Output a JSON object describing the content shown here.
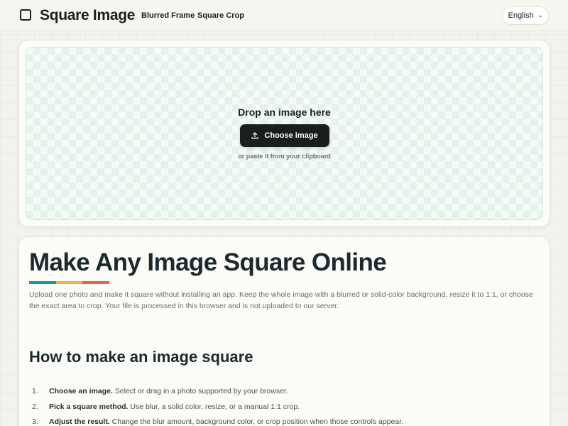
{
  "header": {
    "brand": "Square Image",
    "logo_icon": "square-outline-icon",
    "nav": [
      {
        "label": "Blurred Frame"
      },
      {
        "label": "Square Crop"
      }
    ],
    "language": {
      "selected": "English",
      "icon": "chevron-down-icon"
    }
  },
  "upload": {
    "title": "Drop an image here",
    "button_label": "Choose image",
    "button_icon": "upload-icon",
    "paste_hint": "or paste it from your clipboard"
  },
  "content": {
    "heading": "Make Any Image Square Online",
    "accent_colors": [
      "#1b9a8f",
      "#e5b54f",
      "#e0664a"
    ],
    "intro": "Upload one photo and make it square without installing an app. Keep the whole image with a blurred or solid-color background, resize it to 1:1, or choose the exact area to crop. Your file is processed in this browser and is not uploaded to our server.",
    "how_to_heading": "How to make an image square",
    "steps": [
      {
        "num": "1.",
        "title": "Choose an image.",
        "text": " Select or drag in a photo supported by your browser."
      },
      {
        "num": "2.",
        "title": "Pick a square method.",
        "text": " Use blur, a solid color, resize, or a manual 1:1 crop."
      },
      {
        "num": "3.",
        "title": "Adjust the result.",
        "text": " Change the blur amount, background color, or crop position when those controls appear."
      }
    ]
  }
}
